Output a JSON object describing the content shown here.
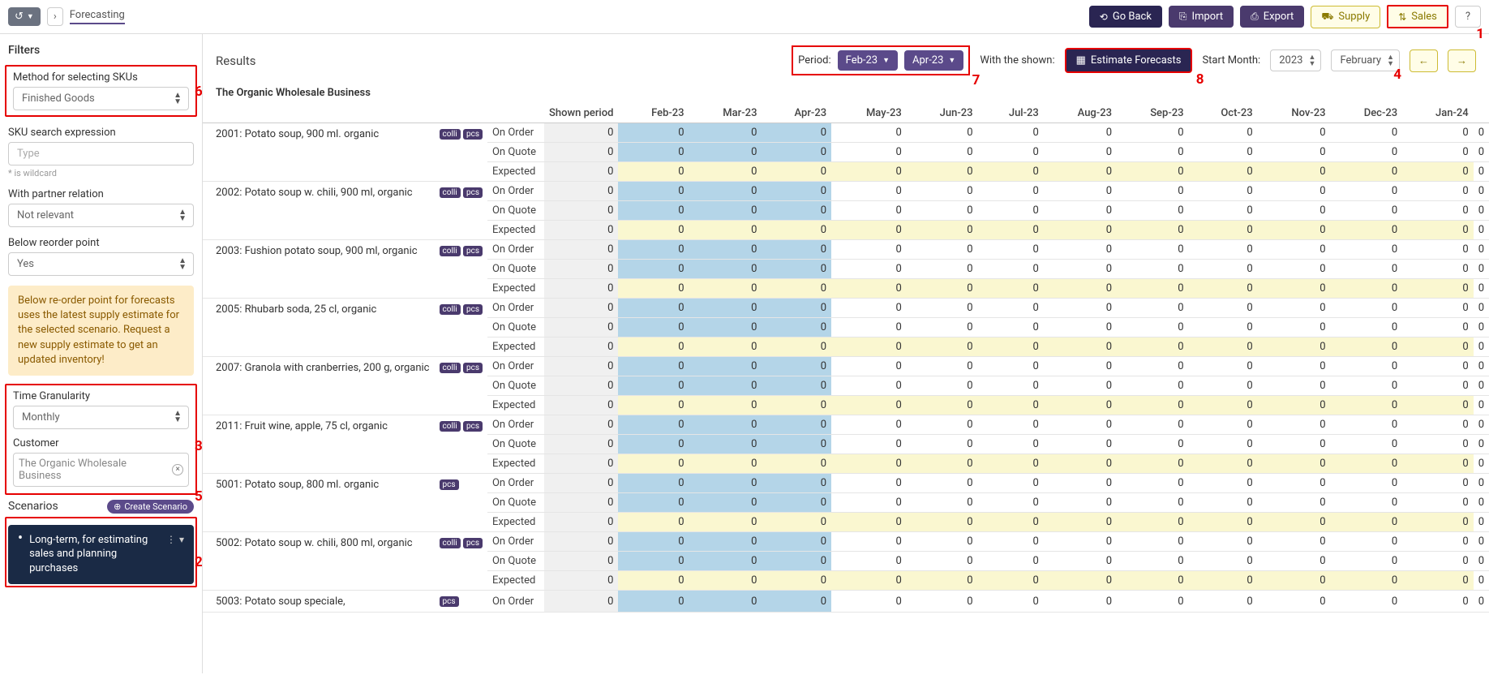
{
  "top": {
    "breadcrumb": "Forecasting",
    "go_back": "Go Back",
    "import": "Import",
    "export": "Export",
    "supply": "Supply",
    "sales": "Sales"
  },
  "filters": {
    "title": "Filters",
    "method_label": "Method for selecting SKUs",
    "method_value": "Finished Goods",
    "search_label": "SKU search expression",
    "search_placeholder": "Type",
    "search_hint": "* is wildcard",
    "partner_label": "With partner relation",
    "partner_value": "Not relevant",
    "reorder_label": "Below reorder point",
    "reorder_value": "Yes",
    "reorder_info": "Below re-order point for forecasts uses the latest supply estimate for the selected scenario. Request a new supply estimate to get an updated inventory!",
    "granularity_label": "Time Granularity",
    "granularity_value": "Monthly",
    "customer_label": "Customer",
    "customer_value": "The Organic Wholesale Business",
    "scenarios_title": "Scenarios",
    "create_scenario": "Create Scenario",
    "scenario_item": "Long-term, for estimating sales and planning purchases"
  },
  "results": {
    "title": "Results",
    "subtitle": "The Organic Wholesale Business",
    "period_label": "Period:",
    "period_from": "Feb-23",
    "period_to": "Apr-23",
    "with_shown": "With the shown:",
    "estimate": "Estimate Forecasts",
    "start_month_label": "Start Month:",
    "start_year": "2023",
    "start_month": "February",
    "columns": [
      "Shown period",
      "Feb-23",
      "Mar-23",
      "Apr-23",
      "May-23",
      "Jun-23",
      "Jul-23",
      "Aug-23",
      "Sep-23",
      "Oct-23",
      "Nov-23",
      "Dec-23",
      "Jan-24",
      ""
    ],
    "row_types": [
      "On Order",
      "On Quote",
      "Expected"
    ],
    "products": [
      {
        "name": "2001: Potato soup, 900 ml. organic",
        "tags": [
          "colli",
          "pcs"
        ]
      },
      {
        "name": "2002: Potato soup w. chili, 900 ml, organic",
        "tags": [
          "colli",
          "pcs"
        ]
      },
      {
        "name": "2003: Fushion potato soup, 900 ml, organic",
        "tags": [
          "colli",
          "pcs"
        ]
      },
      {
        "name": "2005: Rhubarb soda, 25 cl, organic",
        "tags": [
          "colli",
          "pcs"
        ]
      },
      {
        "name": "2007: Granola with cranberries, 200 g, organic",
        "tags": [
          "colli",
          "pcs"
        ]
      },
      {
        "name": "2011: Fruit wine, apple, 75 cl, organic",
        "tags": [
          "colli",
          "pcs"
        ]
      },
      {
        "name": "5001: Potato soup, 800 ml. organic",
        "tags": [
          "pcs"
        ]
      },
      {
        "name": "5002: Potato soup w. chili, 800 ml, organic",
        "tags": [
          "colli",
          "pcs"
        ]
      },
      {
        "name": "5003: Potato soup speciale,",
        "tags": [
          "pcs"
        ]
      }
    ],
    "zero": "0",
    "zero_trail": "0"
  },
  "annotations": {
    "a1": "1",
    "a2": "2",
    "a3": "3",
    "a4": "4",
    "a5": "5",
    "a6": "6",
    "a7": "7",
    "a8": "8"
  }
}
